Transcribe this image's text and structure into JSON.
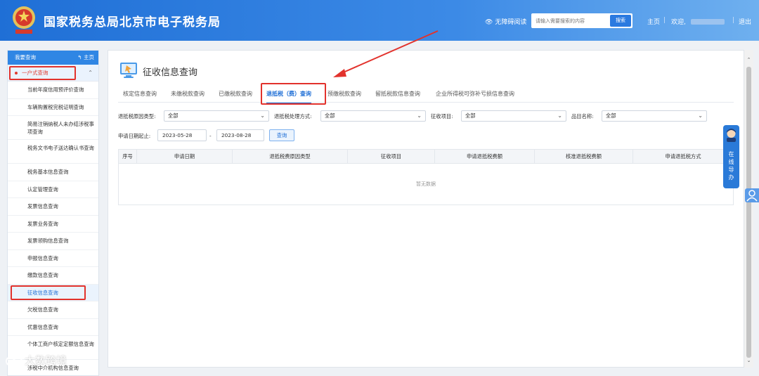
{
  "header": {
    "site_title": "国家税务总局北京市电子税务局",
    "accessibility": "无障碍阅读",
    "search_placeholder": "请输入需要搜索的内容",
    "search_button": "搜索",
    "home": "主页",
    "welcome": "欢迎,",
    "logout": "退出"
  },
  "sidebar": {
    "title": "我要查询",
    "home": "主页",
    "group": "一户式查询",
    "items": [
      "当前年度信用预评价查询",
      "车辆购置税完税证明查询",
      "简易注销纳税人未办结涉税事项查询",
      "税务文书电子送达确认书查询",
      "税务基本信息查询",
      "认定管理查询",
      "发票信息查询",
      "发票业务查询",
      "发票领购信息查询",
      "申报信息查询",
      "缴款信息查询",
      "征收信息查询",
      "欠税信息查询",
      "优惠信息查询",
      "个体工商户核定定额信息查询",
      "涉税中介机构信息查询"
    ]
  },
  "main": {
    "title": "征收信息查询",
    "tabs": [
      "核定信息查询",
      "未缴税款查询",
      "已缴税款查询",
      "退抵税（费）查询",
      "预缴税款查询",
      "留抵税款信息查询",
      "企业所得税可弥补亏损信息查询"
    ],
    "filters": {
      "refund_reason_label": "退抵税原因类型:",
      "refund_reason_value": "全部",
      "refund_method_label": "退抵税处理方式:",
      "refund_method_value": "全部",
      "levy_item_label": "征收项目:",
      "levy_item_value": "全部",
      "item_name_label": "品目名称:",
      "item_name_value": "全部",
      "date_label": "申请日期起止:",
      "date_start": "2023-05-28",
      "date_sep": "-",
      "date_end": "2023-08-28",
      "query_button": "查询"
    },
    "table": {
      "columns": [
        "序号",
        "申请日期",
        "退抵税费原因类型",
        "征收项目",
        "申请退抵税费额",
        "核准退抵税费额",
        "申请退抵税方式"
      ],
      "empty_text": "暂无数据"
    }
  },
  "float_tab": {
    "chars": [
      "在",
      "线",
      "导",
      "办"
    ]
  },
  "watermark": "大数跨境",
  "colors": {
    "header_blue": "#1f6fd6",
    "accent_blue": "#2f86e4",
    "highlight_red": "#e2322c"
  }
}
